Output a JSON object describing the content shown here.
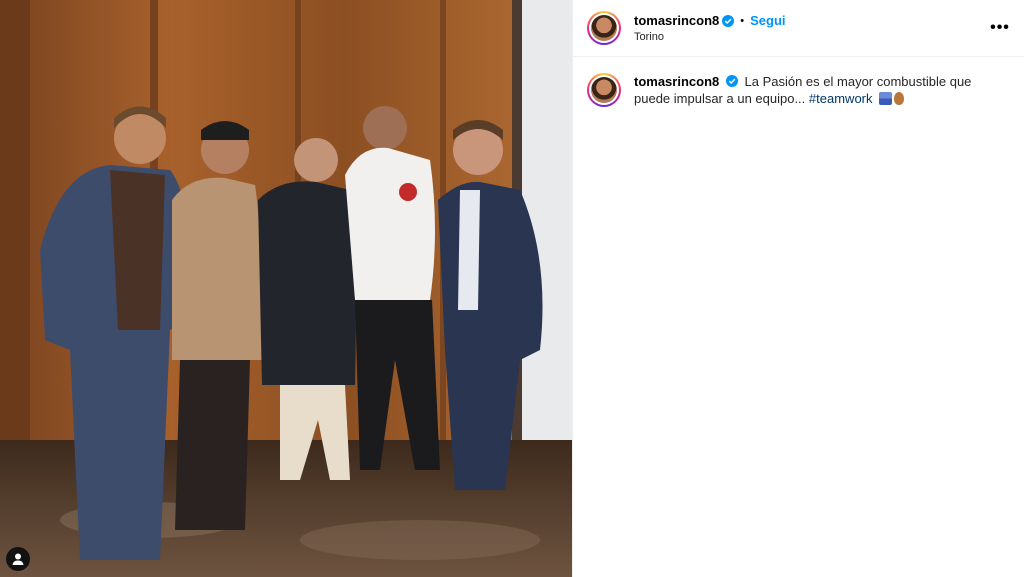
{
  "post": {
    "username": "tomasrincon8",
    "separator": "•",
    "follow_label": "Segui",
    "location": "Torino",
    "more_label": "•••"
  },
  "caption": {
    "username": "tomasrincon8",
    "text": "La Pasión es el mayor combustible que puede impulsar a un equipo...",
    "hashtag": "#teamwork"
  },
  "icons": {
    "verified": "verified-badge-icon",
    "more": "more-options-icon",
    "tag": "user-tag-icon"
  },
  "colors": {
    "accent": "#0095f6",
    "hashtag": "#00376b",
    "verified": "#0095f6"
  }
}
